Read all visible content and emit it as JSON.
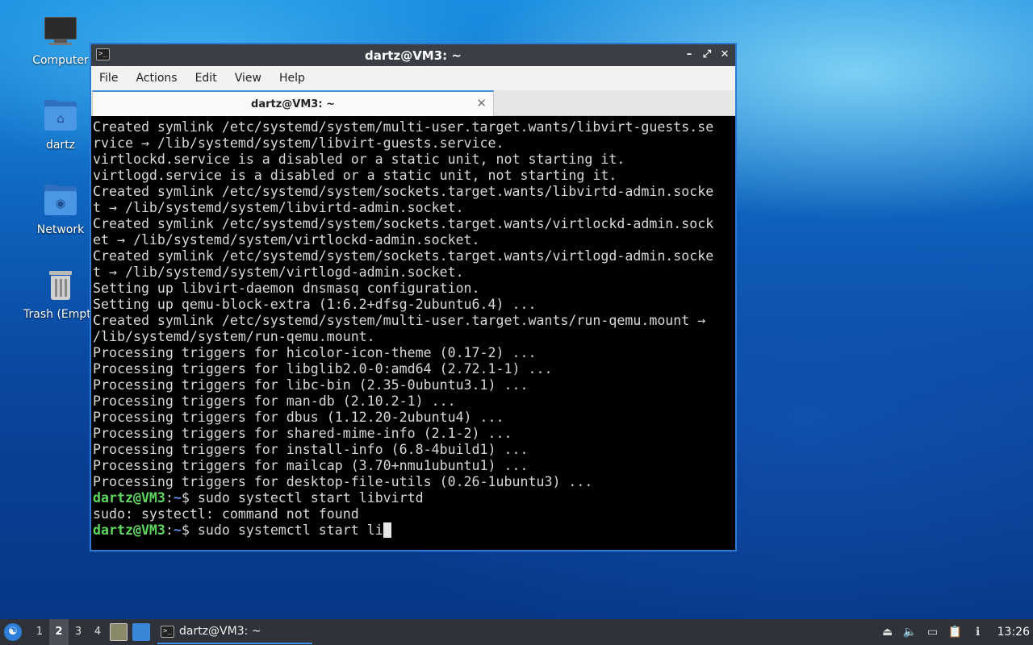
{
  "desktop": {
    "icons": [
      {
        "label": "Computer"
      },
      {
        "label": "dartz"
      },
      {
        "label": "Network"
      },
      {
        "label": "Trash (Empty)"
      }
    ]
  },
  "window": {
    "title": "dartz@VM3: ~",
    "menu": [
      "File",
      "Actions",
      "Edit",
      "View",
      "Help"
    ],
    "tab_title": "dartz@VM3: ~"
  },
  "terminal": {
    "lines": [
      "Created symlink /etc/systemd/system/multi-user.target.wants/libvirt-guests.se",
      "rvice → /lib/systemd/system/libvirt-guests.service.",
      "virtlockd.service is a disabled or a static unit, not starting it.",
      "virtlogd.service is a disabled or a static unit, not starting it.",
      "Created symlink /etc/systemd/system/sockets.target.wants/libvirtd-admin.socke",
      "t → /lib/systemd/system/libvirtd-admin.socket.",
      "Created symlink /etc/systemd/system/sockets.target.wants/virtlockd-admin.sock",
      "et → /lib/systemd/system/virtlockd-admin.socket.",
      "Created symlink /etc/systemd/system/sockets.target.wants/virtlogd-admin.socke",
      "t → /lib/systemd/system/virtlogd-admin.socket.",
      "Setting up libvirt-daemon dnsmasq configuration.",
      "Setting up qemu-block-extra (1:6.2+dfsg-2ubuntu6.4) ...",
      "Created symlink /etc/systemd/system/multi-user.target.wants/run-qemu.mount →",
      "/lib/systemd/system/run-qemu.mount.",
      "Processing triggers for hicolor-icon-theme (0.17-2) ...",
      "Processing triggers for libglib2.0-0:amd64 (2.72.1-1) ...",
      "Processing triggers for libc-bin (2.35-0ubuntu3.1) ...",
      "Processing triggers for man-db (2.10.2-1) ...",
      "Processing triggers for dbus (1.12.20-2ubuntu4) ...",
      "Processing triggers for shared-mime-info (2.1-2) ...",
      "Processing triggers for install-info (6.8-4build1) ...",
      "Processing triggers for mailcap (3.70+nmu1ubuntu1) ...",
      "Processing triggers for desktop-file-utils (0.26-1ubuntu3) ..."
    ],
    "prompt_user": "dartz@VM3",
    "prompt_sep": ":",
    "prompt_path": "~",
    "prompt_dollar": "$ ",
    "cmd1": "sudo systectl start libvirtd",
    "output1": "sudo: systectl: command not found",
    "cmd2": "sudo systemctl start li"
  },
  "taskbar": {
    "workspaces": [
      "1",
      "2",
      "3",
      "4"
    ],
    "active_workspace": "2",
    "task_label": "dartz@VM3: ~",
    "clock": "13:26"
  },
  "colors": {
    "prompt_user": "#5fd75f",
    "prompt_path": "#5f8fe8",
    "accent": "#3c8ee0"
  }
}
